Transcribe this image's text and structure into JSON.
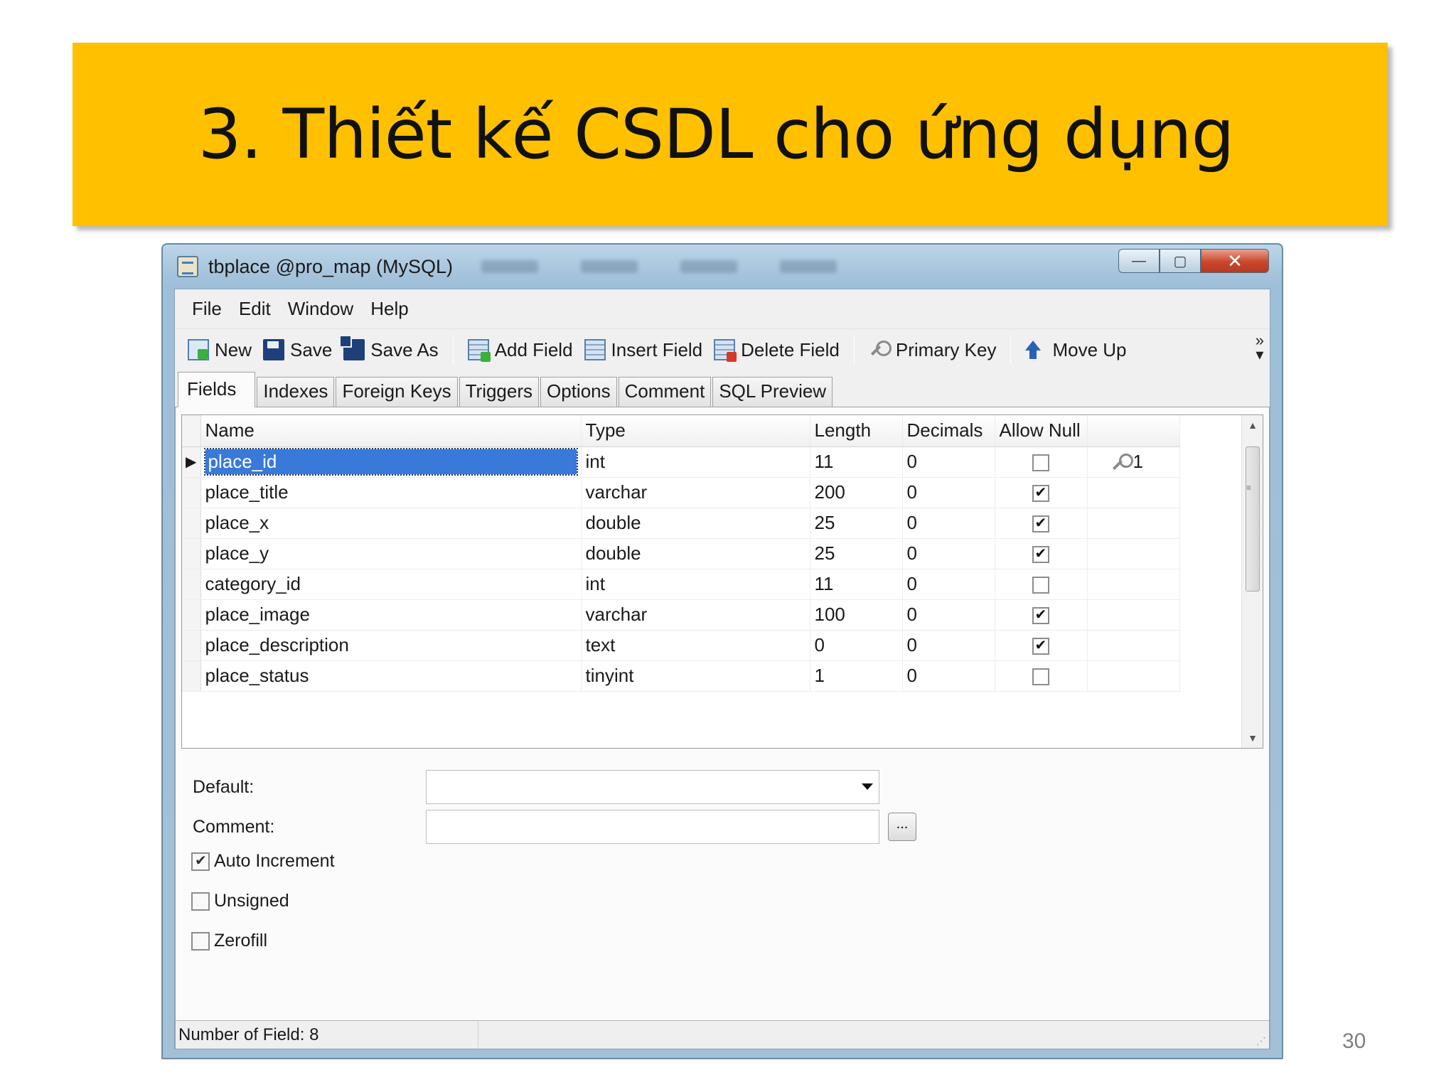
{
  "slide": {
    "title": "3. Thiết kế CSDL cho ứng dụng",
    "page_number": "30",
    "banner_color": "#ffc000"
  },
  "window": {
    "title": "tbplace @pro_map (MySQL)",
    "caption_buttons": {
      "minimize": "—",
      "maximize": "▢",
      "close": "✕"
    }
  },
  "menu": [
    "File",
    "Edit",
    "Window",
    "Help"
  ],
  "toolbar": {
    "new": "New",
    "save": "Save",
    "save_as": "Save As",
    "add_field": "Add Field",
    "insert_field": "Insert Field",
    "delete_field": "Delete Field",
    "primary_key": "Primary Key",
    "move_up": "Move Up",
    "overflow": "»"
  },
  "tabs": [
    "Fields",
    "Indexes",
    "Foreign Keys",
    "Triggers",
    "Options",
    "Comment",
    "SQL Preview"
  ],
  "grid": {
    "headers": {
      "name": "Name",
      "type": "Type",
      "length": "Length",
      "decimals": "Decimals",
      "allow_null": "Allow Null"
    },
    "rows": [
      {
        "name": "place_id",
        "type": "int",
        "length": "11",
        "decimals": "0",
        "allow_null": false,
        "key": "1"
      },
      {
        "name": "place_title",
        "type": "varchar",
        "length": "200",
        "decimals": "0",
        "allow_null": true,
        "key": ""
      },
      {
        "name": "place_x",
        "type": "double",
        "length": "25",
        "decimals": "0",
        "allow_null": true,
        "key": ""
      },
      {
        "name": "place_y",
        "type": "double",
        "length": "25",
        "decimals": "0",
        "allow_null": true,
        "key": ""
      },
      {
        "name": "category_id",
        "type": "int",
        "length": "11",
        "decimals": "0",
        "allow_null": false,
        "key": ""
      },
      {
        "name": "place_image",
        "type": "varchar",
        "length": "100",
        "decimals": "0",
        "allow_null": true,
        "key": ""
      },
      {
        "name": "place_description",
        "type": "text",
        "length": "0",
        "decimals": "0",
        "allow_null": true,
        "key": ""
      },
      {
        "name": "place_status",
        "type": "tinyint",
        "length": "1",
        "decimals": "0",
        "allow_null": false,
        "key": ""
      }
    ]
  },
  "properties": {
    "default_label": "Default:",
    "default_value": "",
    "comment_label": "Comment:",
    "comment_value": "",
    "browse_button": "...",
    "auto_increment": {
      "label": "Auto Increment",
      "checked": true
    },
    "unsigned": {
      "label": "Unsigned",
      "checked": false
    },
    "zerofill": {
      "label": "Zerofill",
      "checked": false
    }
  },
  "status": {
    "field_count": "Number of Field: 8"
  }
}
